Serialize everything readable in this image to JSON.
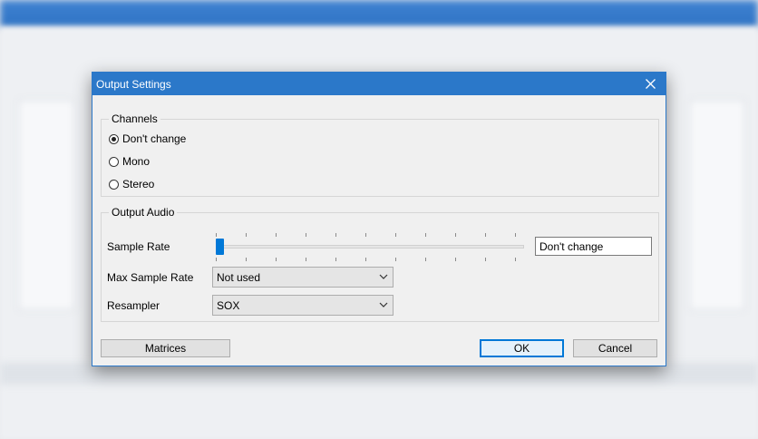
{
  "dialog": {
    "title": "Output Settings",
    "close_icon": "close-icon"
  },
  "channels": {
    "group_label": "Channels",
    "options": [
      {
        "label": "Don't change",
        "selected": true
      },
      {
        "label": "Mono",
        "selected": false
      },
      {
        "label": "Stereo",
        "selected": false
      }
    ]
  },
  "output_audio": {
    "group_label": "Output Audio",
    "sample_rate": {
      "label": "Sample Rate",
      "slider_position": 0,
      "value_text": "Don't change"
    },
    "max_sample_rate": {
      "label": "Max Sample Rate",
      "value": "Not used"
    },
    "resampler": {
      "label": "Resampler",
      "value": "SOX"
    }
  },
  "buttons": {
    "matrices": "Matrices",
    "ok": "OK",
    "cancel": "Cancel"
  },
  "colors": {
    "titlebar": "#2b78c9",
    "accent": "#0078d7"
  }
}
